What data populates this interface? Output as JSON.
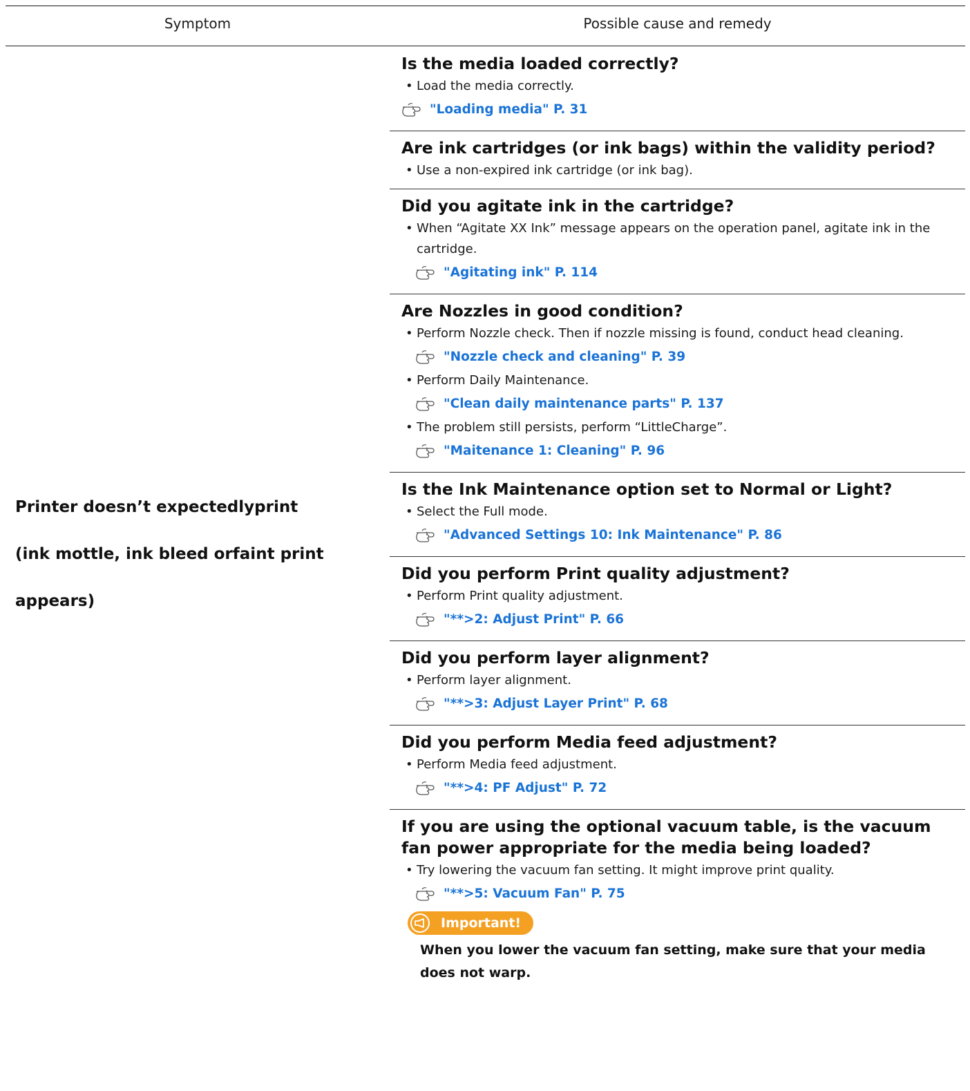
{
  "table": {
    "header": {
      "symptom": "Symptom",
      "cause": "Possible cause and remedy"
    },
    "symptom": {
      "line1": "Printer doesn’t expectedlyprint",
      "line2": "(ink mottle, ink bleed orfaint print",
      "line3": "appears)"
    }
  },
  "remedies": [
    {
      "question": "Is the media loaded correctly?",
      "bullet": "Load the media correctly.",
      "ref": "\"Loading media\" P. 31"
    },
    {
      "question": "Are ink cartridges (or ink bags) within the validity period?",
      "bullet": "Use a non-expired ink cartridge (or ink bag)."
    },
    {
      "question": "Did you agitate ink in the cartridge?",
      "bullet": "When “Agitate XX Ink” message appears on the operation panel, agitate ink in the cartridge.",
      "ref": "\"Agitating ink\" P. 114"
    },
    {
      "question": "Are Nozzles in good condition?",
      "bullet1": "Perform Nozzle check. Then if nozzle missing is found, conduct head cleaning.",
      "ref1": "\"Nozzle check and cleaning\" P. 39",
      "bullet2": "Perform Daily Maintenance.",
      "ref2": "\"Clean daily maintenance parts\" P. 137",
      "bullet3": "The problem still persists, perform “LittleCharge”.",
      "ref3": "\"Maitenance 1: Cleaning\" P. 96"
    },
    {
      "question": "Is the Ink Maintenance option set to Normal or Light?",
      "bullet": "Select the Full mode.",
      "ref": "\"Advanced Settings 10: Ink Maintenance\" P. 86"
    },
    {
      "question": "Did you perform Print quality adjustment?",
      "bullet": "Perform Print quality adjustment.",
      "ref": "\"**>2: Adjust Print\" P. 66"
    },
    {
      "question": "Did you perform layer alignment?",
      "bullet": "Perform layer alignment.",
      "ref": "\"**>3: Adjust Layer Print\" P. 68"
    },
    {
      "question": "Did you perform Media feed adjustment?",
      "bullet": "Perform Media feed adjustment.",
      "ref": "\"**>4: PF Adjust\" P. 72"
    },
    {
      "question": "If you are using the optional vacuum table, is the vacuum fan power appropriate for the media being loaded?",
      "bullet": "Try lowering the vacuum fan setting. It might improve print quality.",
      "ref": "\"**>5: Vacuum Fan\" P. 75",
      "important_label": "Important!",
      "important_text": "When you lower the vacuum fan setting, make sure that your media does not warp."
    }
  ],
  "colors": {
    "link": "#1a73d6",
    "important_badge": "#f4a023",
    "text": "#1a1a1a"
  },
  "icons": {
    "reference": "pointing-hand-icon",
    "important": "megaphone-icon"
  }
}
